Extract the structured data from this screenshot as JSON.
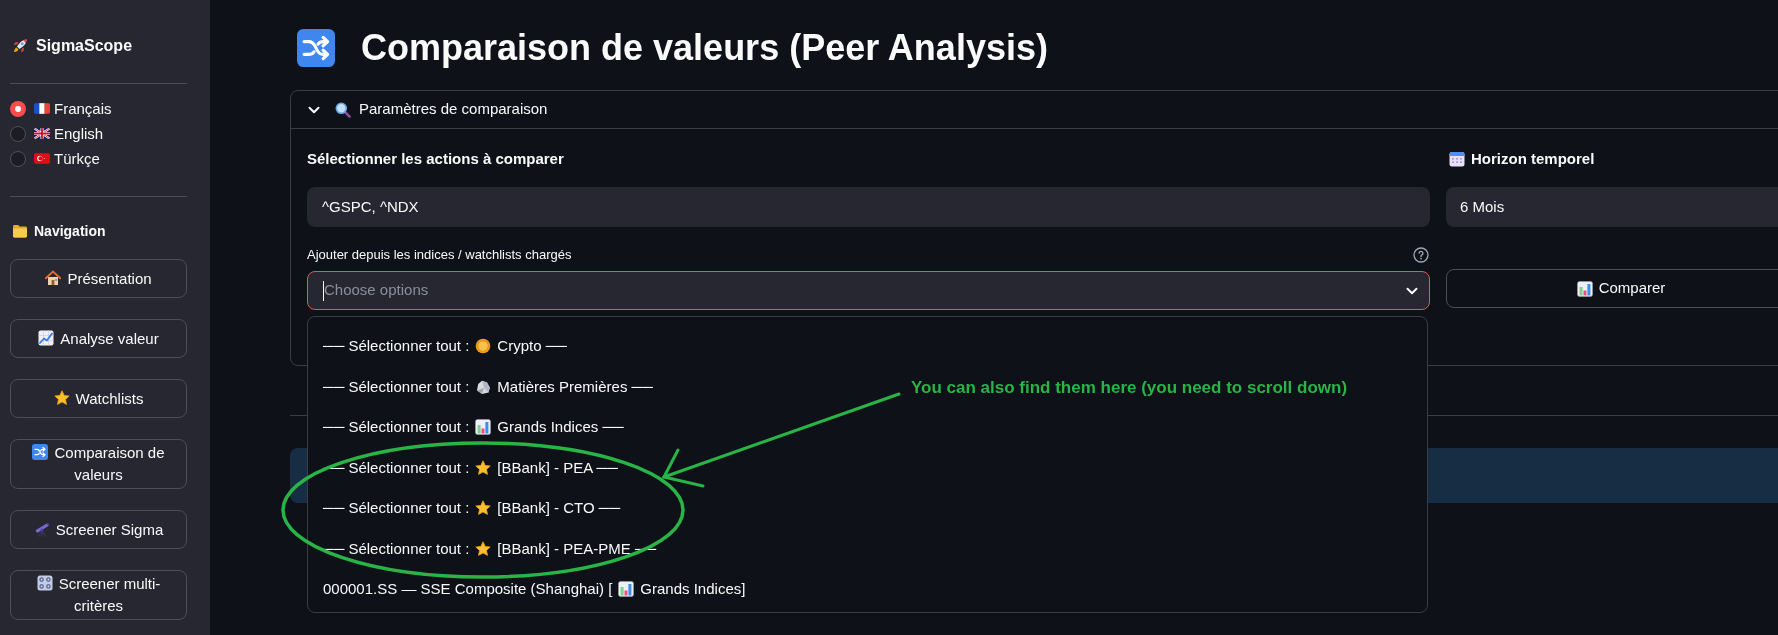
{
  "sidebar": {
    "brand": "SigmaScope",
    "languages": [
      {
        "label": "Français",
        "selected": true
      },
      {
        "label": "English",
        "selected": false
      },
      {
        "label": "Türkçe",
        "selected": false
      }
    ],
    "navigation_heading": "Navigation",
    "nav_buttons": [
      "Présentation",
      "Analyse valeur",
      "Watchlists",
      "Comparaison de valeurs",
      "Screener Sigma",
      "Screener multi-critères"
    ]
  },
  "page": {
    "title": "Comparaison de valeurs (Peer Analysis)"
  },
  "expander": {
    "title": "Paramètres de comparaison",
    "expanded": true,
    "stocks_field": {
      "label": "Sélectionner les actions à comparer",
      "value": "^GSPC, ^NDX"
    },
    "horizon_field": {
      "label": "Horizon temporel",
      "value": "6 Mois"
    },
    "add_field": {
      "label": "Ajouter depuis les indices / watchlists chargés",
      "placeholder": "Choose options",
      "focused": true,
      "open": true,
      "options": [
        {
          "before": "── Sélectionner tout :",
          "after": "Crypto ──"
        },
        {
          "before": "── Sélectionner tout :",
          "after": "Matières Premières ──"
        },
        {
          "before": "── Sélectionner tout :",
          "after": "Grands Indices ──"
        },
        {
          "before": "── Sélectionner tout :",
          "after": "[BBank] - PEA ──"
        },
        {
          "before": "── Sélectionner tout :",
          "after": "[BBank] - CTO ──"
        },
        {
          "before": "── Sélectionner tout :",
          "after": "[BBank] - PEA-PME ──"
        },
        {
          "before": "000001.SS — SSE Composite (Shanghai) [",
          "after": "Grands Indices]"
        }
      ]
    },
    "compare_button": "Comparer"
  },
  "annotation": {
    "text": "You can also find them here (you need to scroll down)"
  }
}
